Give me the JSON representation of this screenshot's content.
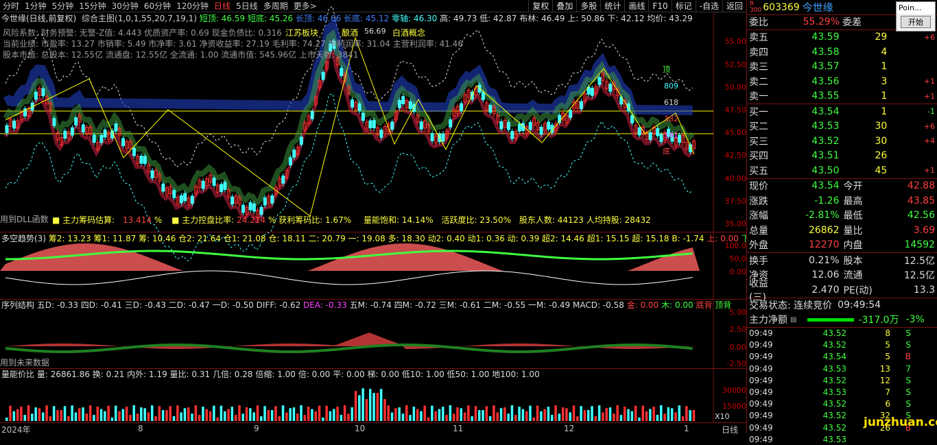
{
  "tabs": [
    "分时",
    "1分钟",
    "5分钟",
    "15分钟",
    "30分钟",
    "60分钟",
    "120分钟",
    "日线",
    "5日线",
    "多周期",
    "更多>"
  ],
  "tools": [
    "复权",
    "叠加",
    "多股",
    "统计",
    "画线",
    "F10",
    "标记",
    "-自选",
    "返回"
  ],
  "main": {
    "line1_name": "今世缘(日线,前复权)",
    "line1_ind": "综合主图(1,0,1,55,20,7,19,1)",
    "short_top": "短顶: 46.59",
    "short_low": "短底: 45.26",
    "long_top": "长顶: 46.66",
    "long_low": "长底: 45.12",
    "zero": "零轴: 46.30",
    "high": "高: 49.73",
    "low": "低: 42.87",
    "bl": "布林: 46.49",
    "up": "上: 50.86",
    "dn": "下: 42.12",
    "avg": "均价: 43.29",
    "info1": "风险系数: 财务预警: 无警-Z值: 4.443 优质资产率: 0.69 现金负债比: 0.316",
    "info2": "当前业绩: 市盈率: 13.27 市销率: 5.49 市净率: 3.61 净资收益率: 27.19 毛利率: 74.27 净利润率: 31.04 主营利润率: 41.46",
    "info3": "股本市值: 总股本: 12.55亿 流通盘: 12.55亿 全流通: 1.00 流通市值: 545.96亿 上市天数: 3841",
    "tag1": "江苏板块",
    "tag2": "酿酒",
    "tag3": "白酒概念",
    "peak": "56.69",
    "dll": "用到DLL函数",
    "chip": "■ 主力筹码估算:",
    "chip_v": "13.414",
    "chip_u": "%",
    "ctrl": "■ 主力控盘比率:",
    "ctrl_v": "24.214",
    "ctrl_u": "%",
    "profit": "获利筹码比: 1.67%",
    "vol_sat": "量能饱和: 14.14%",
    "active": "活跃度比: 23.50%",
    "holders": "股东人数: 44123 人均持股: 28432",
    "fib": [
      "顶",
      "809",
      "618",
      "382",
      "191",
      "底"
    ],
    "yaxis": [
      "55.00",
      "52.50",
      "50.00",
      "47.50",
      "45.00",
      "42.50",
      "40.00",
      "37.50",
      "35.00"
    ]
  },
  "p2": {
    "title": "多空趋势(3)",
    "vals": "筹2: 13.23 筹1: 11.87 筹: 10.46 仓2: 21.64 仓1: 21.08 仓: 18.11 二: 20.79 一: 19.08 多: 18.30 动2: 0.40 动1: 0.36 动: 0.39 超2: 14.46 超1: 15.15 超: 15.18 B: -1.74",
    "up": "上: 0.00",
    "dn": "下:",
    "yaxis": [
      "100.0",
      "50.0",
      "0.00"
    ]
  },
  "p3": {
    "title": "序列结构",
    "vals": "五D: -0.33 四D: -0.41 三D: -0.43 二D: -0.47 一D: -0.50 DIFF: -0.62",
    "dea": "DEA: -0.33",
    "vals2": "五M: -0.74 四M: -0.72 三M: -0.61 二M: -0.55 一M: -0.49 MACD: -0.58",
    "gold": "金: 0.00",
    "wood": "木: 0.00",
    "bot": "底背",
    "top": "顶背",
    "future": "用到未来数据",
    "yaxis": [
      "5.00",
      "2.50",
      "0.00",
      "-2.50"
    ]
  },
  "p4": {
    "title": "量能价比",
    "vals": "量: 26861.86 换: 0.21 内外: 1.19 量比: 0.31 几倍: 0.28 倍缩: 1.00 倍: 0.00 平: 0.00 梯: 0.00 低10: 1.00 低50: 1.00 地100: 1.00",
    "yaxis": [
      "30000",
      "15000"
    ],
    "mult": "X10"
  },
  "xaxis": [
    "2024年",
    "8",
    "9",
    "10",
    "11",
    "12",
    "1"
  ],
  "period": "日线",
  "stock": {
    "code": "603369",
    "name": "今世缘",
    "wb_label": "委比",
    "wb": "55.29%",
    "wc_label": "委差"
  },
  "asks": [
    {
      "l": "卖五",
      "p": "43.59",
      "v": "29",
      "c": "+6"
    },
    {
      "l": "卖四",
      "p": "43.58",
      "v": "4",
      "c": ""
    },
    {
      "l": "卖三",
      "p": "43.57",
      "v": "1",
      "c": ""
    },
    {
      "l": "卖二",
      "p": "43.56",
      "v": "3",
      "c": "+1"
    },
    {
      "l": "卖一",
      "p": "43.55",
      "v": "1",
      "c": "+1"
    }
  ],
  "bids": [
    {
      "l": "买一",
      "p": "43.54",
      "v": "1",
      "c": "-1"
    },
    {
      "l": "买二",
      "p": "43.53",
      "v": "30",
      "c": "+6"
    },
    {
      "l": "买三",
      "p": "43.52",
      "v": "30",
      "c": "+4"
    },
    {
      "l": "买四",
      "p": "43.51",
      "v": "26",
      "c": ""
    },
    {
      "l": "买五",
      "p": "43.50",
      "v": "45",
      "c": "+1"
    }
  ],
  "quote": [
    {
      "a": "现价",
      "av": "43.54",
      "b": "今开",
      "bv": "42.88"
    },
    {
      "a": "涨跌",
      "av": "-1.26",
      "b": "最高",
      "bv": "43.85"
    },
    {
      "a": "涨幅",
      "av": "-2.81%",
      "b": "最低",
      "bv": "42.56"
    },
    {
      "a": "总量",
      "av": "26862",
      "b": "量比",
      "bv": "3.69"
    },
    {
      "a": "外盘",
      "av": "12270",
      "b": "内盘",
      "bv": "14592"
    }
  ],
  "quote2": [
    {
      "a": "换手",
      "av": "0.21%",
      "b": "股本",
      "bv": "12.5亿"
    },
    {
      "a": "净资",
      "av": "12.06",
      "b": "流通",
      "bv": "12.5亿"
    },
    {
      "a": "收益(三)",
      "av": "2.470",
      "b": "PE(动)",
      "bv": "13.3"
    }
  ],
  "trade_state": "交易状态: 连续竞价",
  "trade_time": "09:49:54",
  "netflow_label": "主力净额",
  "netflow": "-317.0万",
  "netflow_pct": "-3%",
  "ticks": [
    {
      "t": "09:49",
      "p": "43.52",
      "v": "8",
      "s": "S"
    },
    {
      "t": "09:49",
      "p": "43.52",
      "v": "5",
      "s": "S"
    },
    {
      "t": "09:49",
      "p": "43.54",
      "v": "5",
      "s": "B"
    },
    {
      "t": "09:49",
      "p": "43.53",
      "v": "13",
      "s": "7"
    },
    {
      "t": "09:49",
      "p": "43.52",
      "v": "12",
      "s": "S"
    },
    {
      "t": "09:49",
      "p": "43.53",
      "v": "7",
      "s": "S"
    },
    {
      "t": "09:49",
      "p": "43.52",
      "v": "6",
      "s": "S"
    },
    {
      "t": "09:49",
      "p": "43.52",
      "v": "32",
      "s": "S"
    },
    {
      "t": "09:49",
      "p": "43.52",
      "v": "26",
      "s": "B"
    },
    {
      "t": "09:49",
      "p": "43.53",
      "v": "",
      "s": ""
    }
  ],
  "popup": {
    "title": "Poin...",
    "btn": "开始"
  },
  "watermark": "junzhuan.com"
}
